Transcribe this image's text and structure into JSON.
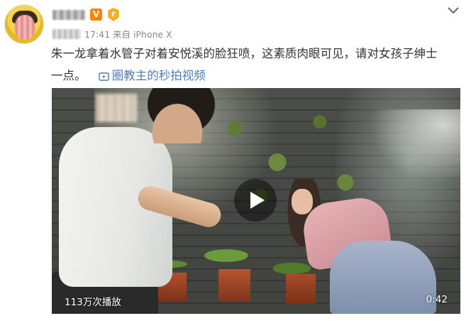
{
  "post": {
    "time": "17:41",
    "source_prefix": "来自",
    "source_device": "iPhone X",
    "vip_badge": "V",
    "text": "朱一龙拿着水管子对着安悦溪的脸狂喷，这素质肉眼可见，请对女孩子绅士一点。",
    "video_link_label": "圈教主的秒拍视频"
  },
  "video": {
    "play_count": "113万次播放",
    "duration": "0:42"
  },
  "icons": {
    "menu": "chevron-down-icon",
    "video": "video-camera-icon",
    "play": "play-icon",
    "vip": "verified-v-icon",
    "level": "level-badge-icon"
  },
  "colors": {
    "link": "#507daf",
    "vip": "#ff8200",
    "meta": "#888888",
    "text": "#333333"
  }
}
